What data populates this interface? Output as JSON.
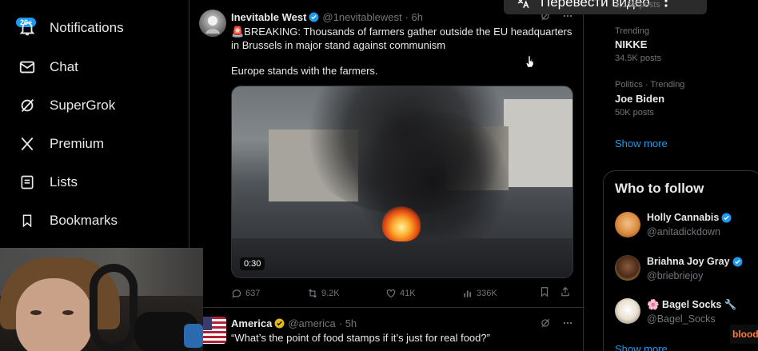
{
  "nav": {
    "badge": "20+",
    "items": [
      {
        "label": "Notifications",
        "icon": "bell-icon"
      },
      {
        "label": "Chat",
        "icon": "mail-icon"
      },
      {
        "label": "SuperGrok",
        "icon": "grok-icon"
      },
      {
        "label": "Premium",
        "icon": "x-logo-icon"
      },
      {
        "label": "Lists",
        "icon": "list-icon"
      },
      {
        "label": "Bookmarks",
        "icon": "bookmark-icon"
      }
    ]
  },
  "overlay": {
    "translate_label": "Перевести видео"
  },
  "tweet1": {
    "name": "Inevitable West",
    "handle": "@1nevitablewest",
    "time": "· 6h",
    "text_line1": "🚨BREAKING: Thousands of farmers gather outside the EU headquarters in Brussels in major stand against communism",
    "text_line2": "Europe stands with the farmers.",
    "video_time": "0:30",
    "replies": "637",
    "reposts": "9.2K",
    "likes": "41K",
    "views": "336K"
  },
  "tweet2": {
    "name": "America",
    "handle": "@america",
    "time": "· 5h",
    "text": "“What’s the point of food stamps if it’s just for real food?”"
  },
  "trends": {
    "top_count": "1,158 posts",
    "items": [
      {
        "context": "Trending",
        "name": "NIKKE",
        "count": "34.5K posts"
      },
      {
        "context": "Politics · Trending",
        "name": "Joe Biden",
        "count": "50K posts"
      }
    ],
    "show_more": "Show more"
  },
  "who_to_follow": {
    "title": "Who to follow",
    "users": [
      {
        "name": "Holly Cannabis",
        "handle": "@anitadickdown"
      },
      {
        "name": "Briahna Joy Gray",
        "handle": "@briebriejoy"
      },
      {
        "name": "🌸 Bagel Socks 🔧",
        "handle": "@Bagel_Socks"
      }
    ],
    "show_more": "Show more"
  },
  "overlay_right": {
    "text": "blood"
  },
  "colors": {
    "accent": "#1d9bf0",
    "background": "#000000",
    "muted_text": "#71767b",
    "border": "#2f3336"
  }
}
